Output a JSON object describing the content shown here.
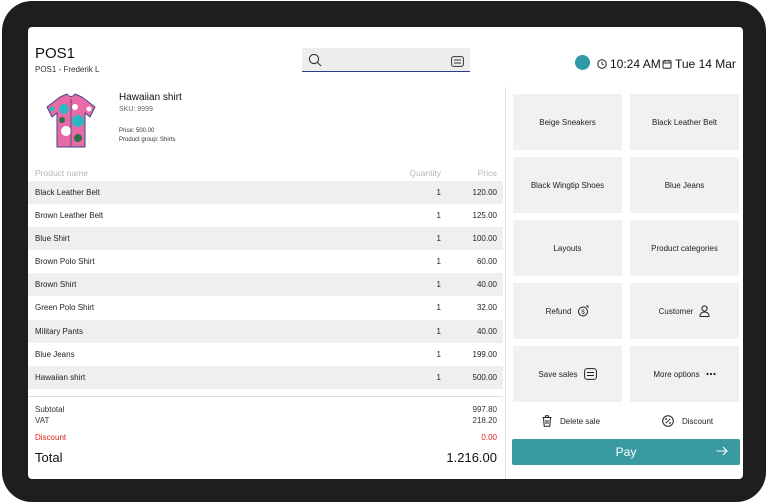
{
  "header": {
    "title": "POS1",
    "subtitle": "POS1 - Frederik L",
    "search_placeholder": "",
    "time": "10:24 AM",
    "date": "Tue 14 Mar",
    "status_color": "#2d9aa5"
  },
  "selected_product": {
    "name": "Hawaiian shirt",
    "sku": "SKU: 9999",
    "price": "Price: 500.00",
    "group": "Product group: Shirts",
    "image_icon": "hawaiian-shirt-image"
  },
  "table": {
    "headers": {
      "name": "Product name",
      "quantity": "Quantity",
      "price": "Price"
    },
    "rows": [
      {
        "name": "Black Leather Belt",
        "qty": "1",
        "price": "120.00"
      },
      {
        "name": "Brown Leather Belt",
        "qty": "1",
        "price": "125.00"
      },
      {
        "name": "Blue Shirt",
        "qty": "1",
        "price": "100.00"
      },
      {
        "name": "Brown Polo Shirt",
        "qty": "1",
        "price": "60.00"
      },
      {
        "name": "Brown Shirt",
        "qty": "1",
        "price": "40.00"
      },
      {
        "name": "Green Polo Shirt",
        "qty": "1",
        "price": "32.00"
      },
      {
        "name": "Military Pants",
        "qty": "1",
        "price": "40.00"
      },
      {
        "name": "Blue Jeans",
        "qty": "1",
        "price": "199.00"
      },
      {
        "name": "Hawaiian shirt",
        "qty": "1",
        "price": "500.00"
      }
    ]
  },
  "totals": {
    "subtotal_label": "Subtotal",
    "subtotal": "997.80",
    "vat_label": "VAT",
    "vat": "218.20",
    "discount_label": "Discount",
    "discount": "0.00",
    "total_label": "Total",
    "total": "1.216.00",
    "discount_color": "#e02020"
  },
  "tiles": {
    "beige_sneakers": "Beige Sneakers",
    "black_leather_belt": "Black Leather Belt",
    "black_wingtip_shoes": "Black Wingtip Shoes",
    "blue_jeans": "Blue Jeans",
    "layouts": "Layouts",
    "product_categories": "Product categories",
    "refund": "Refund",
    "customer": "Customer",
    "save_sales": "Save sales",
    "more_options": "More options"
  },
  "actions": {
    "delete_sale": "Delete sale",
    "discount": "Discount",
    "pay": "Pay",
    "pay_color": "#3a9aa1"
  },
  "icons": [
    "search-icon",
    "keyboard-icon",
    "clock-icon",
    "calendar-icon",
    "refund-icon",
    "user-icon",
    "save-sales-icon",
    "more-dots-icon",
    "trash-icon",
    "percent-icon",
    "arrow-right-icon"
  ]
}
